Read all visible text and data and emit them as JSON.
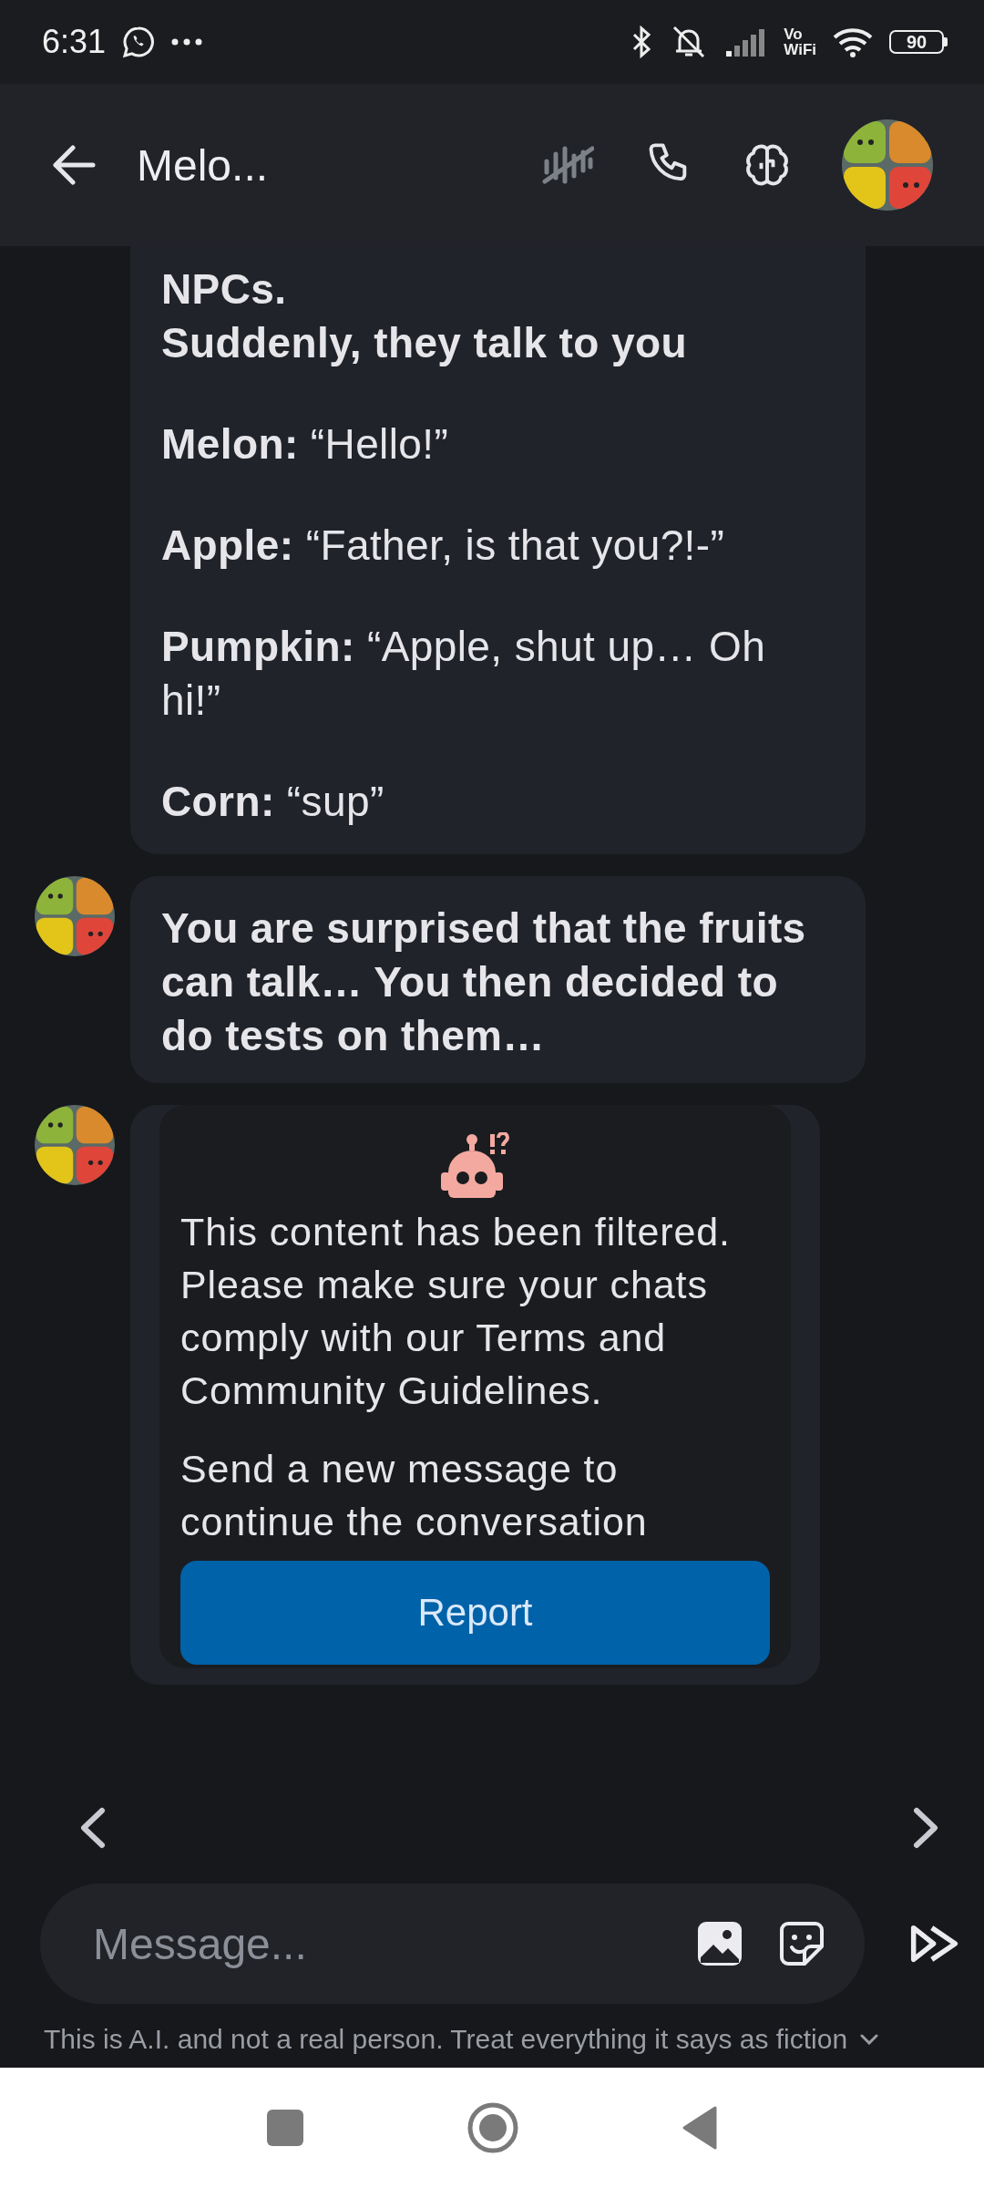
{
  "status_bar": {
    "time": "6:31",
    "network_label_top": "Vo",
    "network_label_bottom": "WiFi",
    "battery": "90"
  },
  "header": {
    "title": "Melo..."
  },
  "messages": [
    {
      "kind": "text",
      "avatar": false,
      "paragraphs": [
        {
          "text": "NPCs.\nSuddenly, they talk to you",
          "bold": true
        },
        {
          "text": "**Melon:** “Hello!”",
          "bold": false
        },
        {
          "text": "**Apple:** “Father, is that you?!-”",
          "bold": false
        },
        {
          "text": "**Pumpkin:** “Apple, shut up… Oh hi!”",
          "bold": false
        },
        {
          "text": "**Corn:** “sup”",
          "bold": false
        }
      ]
    },
    {
      "kind": "text",
      "avatar": true,
      "paragraphs": [
        {
          "text": "You are surprised that the fruits can talk… You then decided to do tests on them…",
          "bold": true
        }
      ]
    },
    {
      "kind": "filtered",
      "avatar": true,
      "paragraphs": [
        {
          "text": "This content has been filtered. Please make sure your chats comply with our Terms and Community Guidelines.",
          "bold": false
        },
        {
          "text": "Send a new message to continue the conversation",
          "bold": false
        }
      ],
      "button": "Report"
    }
  ],
  "composer": {
    "placeholder": "Message..."
  },
  "disclaimer": "This is A.I. and not a real person. Treat everything it says as fiction"
}
